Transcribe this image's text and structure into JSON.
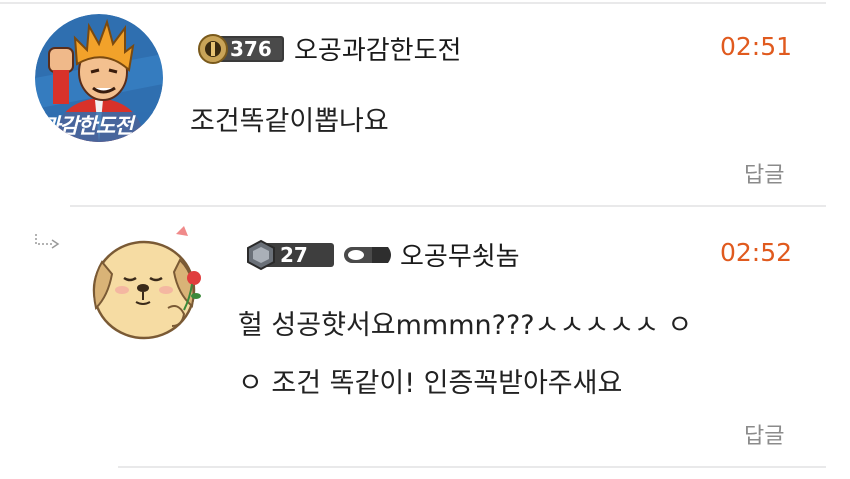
{
  "comments": [
    {
      "badge_level": "376",
      "nickname": "오공과감한도전",
      "time": "02:51",
      "text": "조건똑같이뽑나요",
      "reply_label": "답글",
      "avatar_text": "과감한도전"
    },
    {
      "badge_level": "27",
      "nickname": "오공무쇳놈",
      "time": "02:52",
      "text_line1": "헐 성공햣서요mmmn???ㅅㅅㅅㅅㅅ ㅇ",
      "text_line2": "ㅇ 조건 똑같이! 인증꼭받아주새요",
      "reply_label": "답글"
    }
  ],
  "colors": {
    "time": "#e05a1e",
    "reply": "#8b8b8b",
    "divider": "#e9e9ea"
  },
  "icons": [
    "rank-badge-icon",
    "reply-arrow-icon",
    "rank-badge-diamond-icon",
    "bullet-rank-icon"
  ]
}
